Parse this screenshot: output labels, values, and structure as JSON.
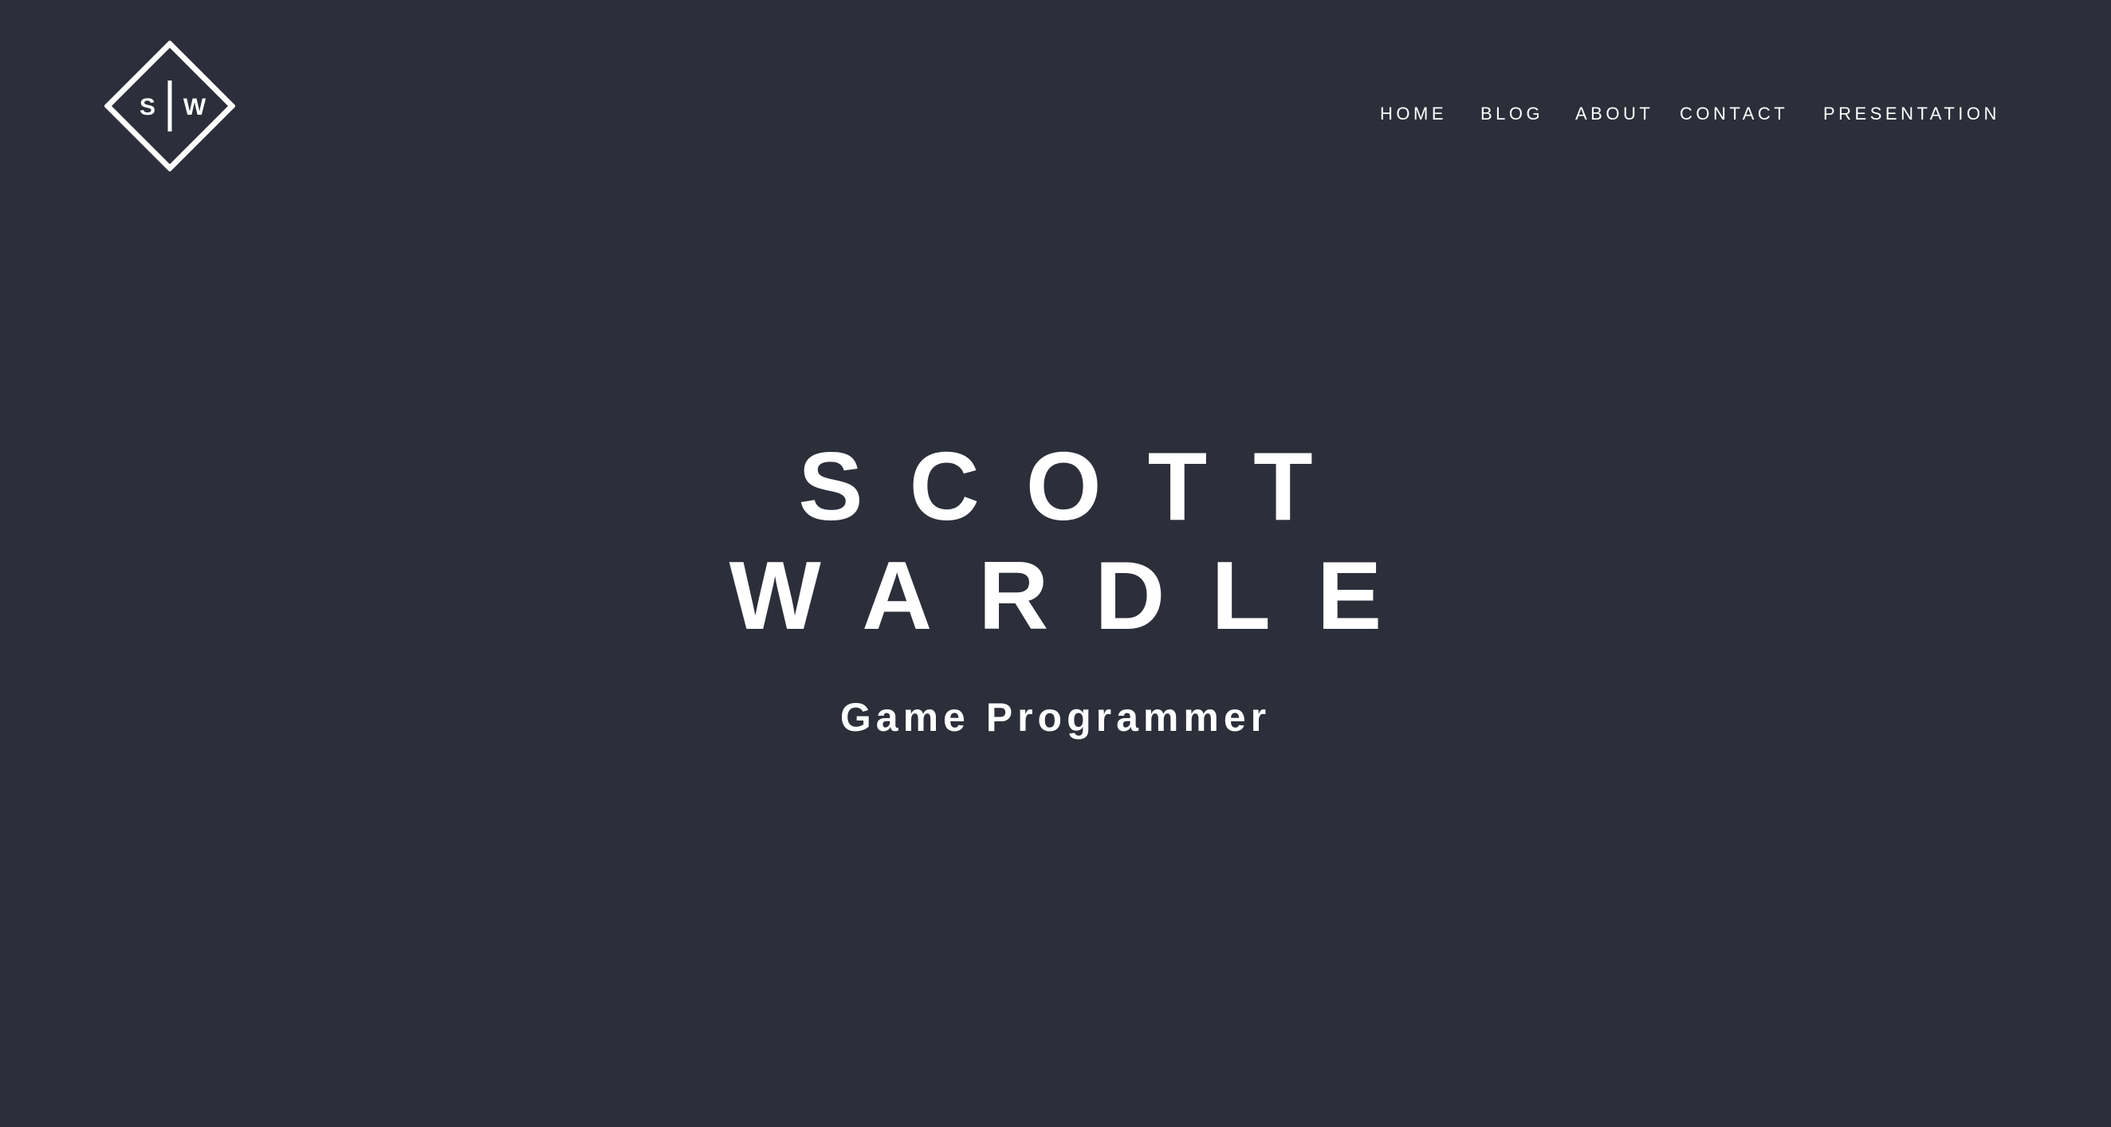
{
  "logo": {
    "left_letter": "S",
    "right_letter": "W",
    "icon": "diamond-monogram-icon"
  },
  "nav": {
    "items": [
      {
        "label": "HOME"
      },
      {
        "label": "BLOG"
      },
      {
        "label": "ABOUT"
      },
      {
        "label": "CONTACT"
      },
      {
        "label": "PRESENTATION"
      }
    ]
  },
  "hero": {
    "first_name": "SCOTT",
    "last_name": "WARDLE",
    "subtitle": "Game Programmer"
  },
  "colors": {
    "background": "#2c2f3a",
    "text": "#ffffff"
  }
}
